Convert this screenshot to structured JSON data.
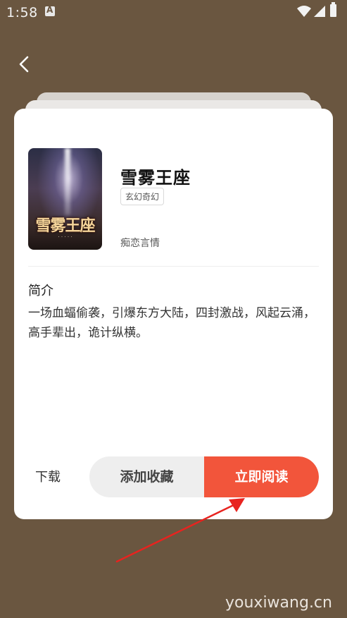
{
  "status_bar": {
    "time": "1:58"
  },
  "book": {
    "title": "雪雾王座",
    "genre": "玄幻奇幻",
    "author": "痴恋言情",
    "cover_title": "雪雾王座"
  },
  "intro": {
    "heading": "简介",
    "text": "一场血蝠偷袭，引爆东方大陆，四封激战，风起云涌，高手辈出，诡计纵横。"
  },
  "actions": {
    "download": "下载",
    "add_favorite": "添加收藏",
    "read_now": "立即阅读"
  },
  "watermark": "youxiwang.cn",
  "colors": {
    "accent": "#f2553b",
    "background": "#6a5640"
  }
}
